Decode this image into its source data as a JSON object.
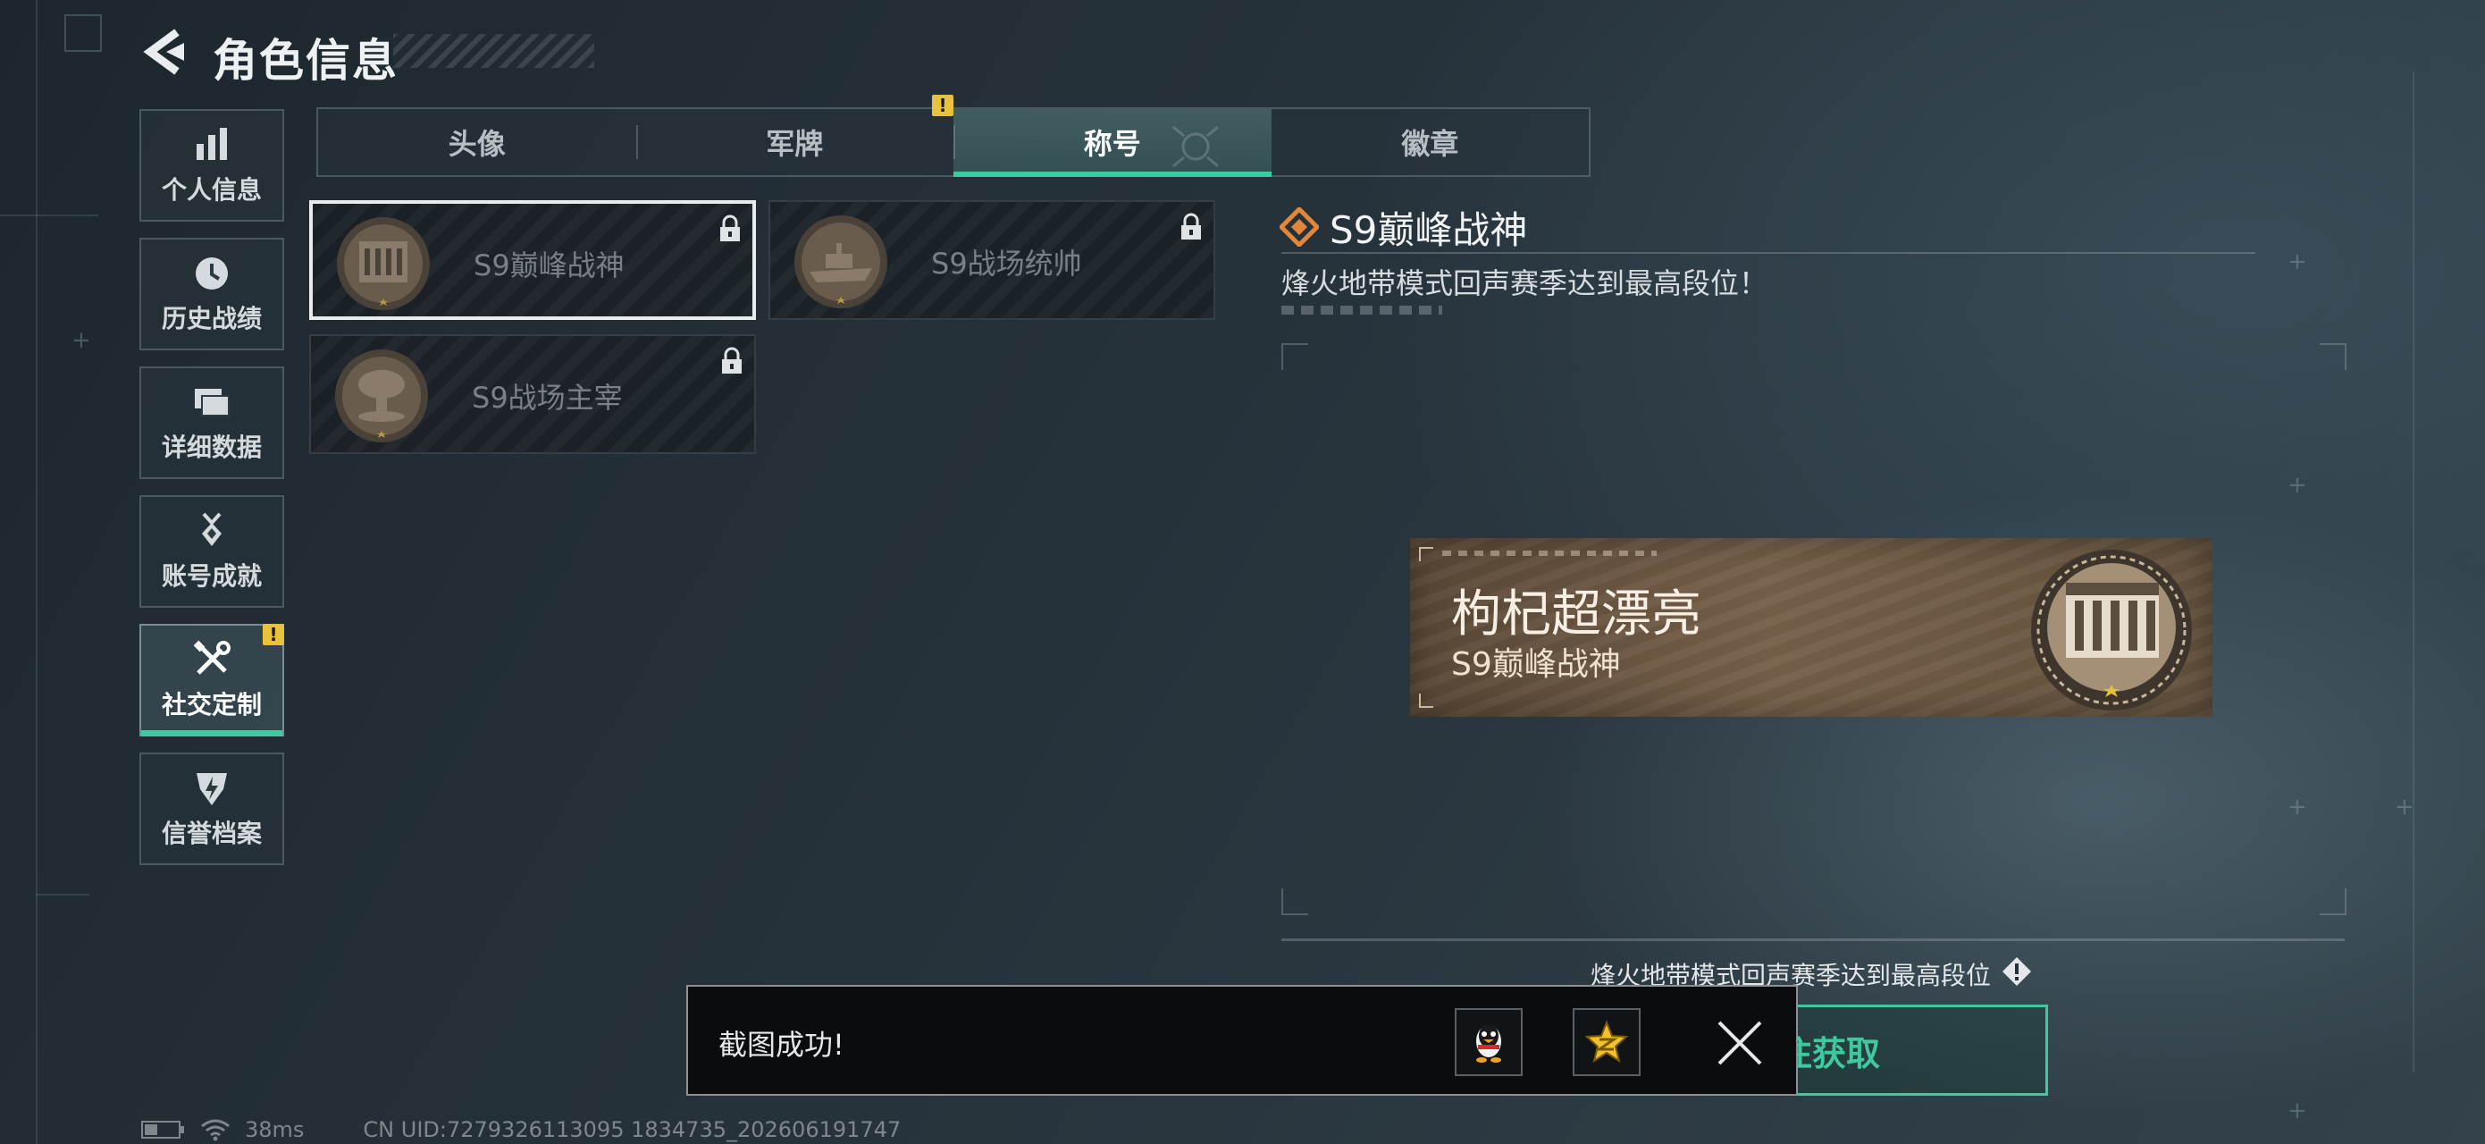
{
  "header": {
    "title": "角色信息"
  },
  "nav": {
    "items": [
      {
        "label": "个人信息",
        "icon": "bar-chart-icon",
        "active": false
      },
      {
        "label": "历史战绩",
        "icon": "clock-icon",
        "active": false
      },
      {
        "label": "详细数据",
        "icon": "folder-icon",
        "active": false
      },
      {
        "label": "账号成就",
        "icon": "medal-icon",
        "active": false
      },
      {
        "label": "社交定制",
        "icon": "tools-icon",
        "active": true,
        "alert": "!"
      },
      {
        "label": "信誉档案",
        "icon": "shield-icon",
        "active": false
      }
    ]
  },
  "tabs": {
    "items": [
      {
        "label": "头像"
      },
      {
        "label": "军牌",
        "alert": "!"
      },
      {
        "label": "称号",
        "active": true
      },
      {
        "label": "徽章"
      }
    ]
  },
  "titles": [
    {
      "label": "S9巅峰战神",
      "locked": true,
      "selected": true,
      "medal": "monument-medal-icon"
    },
    {
      "label": "S9战场统帅",
      "locked": true,
      "selected": false,
      "medal": "warship-medal-icon"
    },
    {
      "label": "S9战场主宰",
      "locked": true,
      "selected": false,
      "medal": "mushroom-cloud-medal-icon"
    }
  ],
  "detail": {
    "title": "S9巅峰战神",
    "description": "烽火地带模式回声赛季达到最高段位！"
  },
  "nameplate": {
    "player_name": "枸杞超漂亮",
    "title": "S9巅峰战神"
  },
  "requirement": {
    "text": "烽火地带模式回声赛季达到最高段位"
  },
  "action": {
    "label": "前往获取"
  },
  "toast": {
    "text": "截图成功!"
  },
  "status": {
    "ping": "38ms",
    "uid": "CN UID:7279326113095 1834735_202606191747"
  },
  "colors": {
    "accent": "#3ec9a0",
    "alert": "#e8c23a",
    "detail_icon": "#e2873a"
  }
}
